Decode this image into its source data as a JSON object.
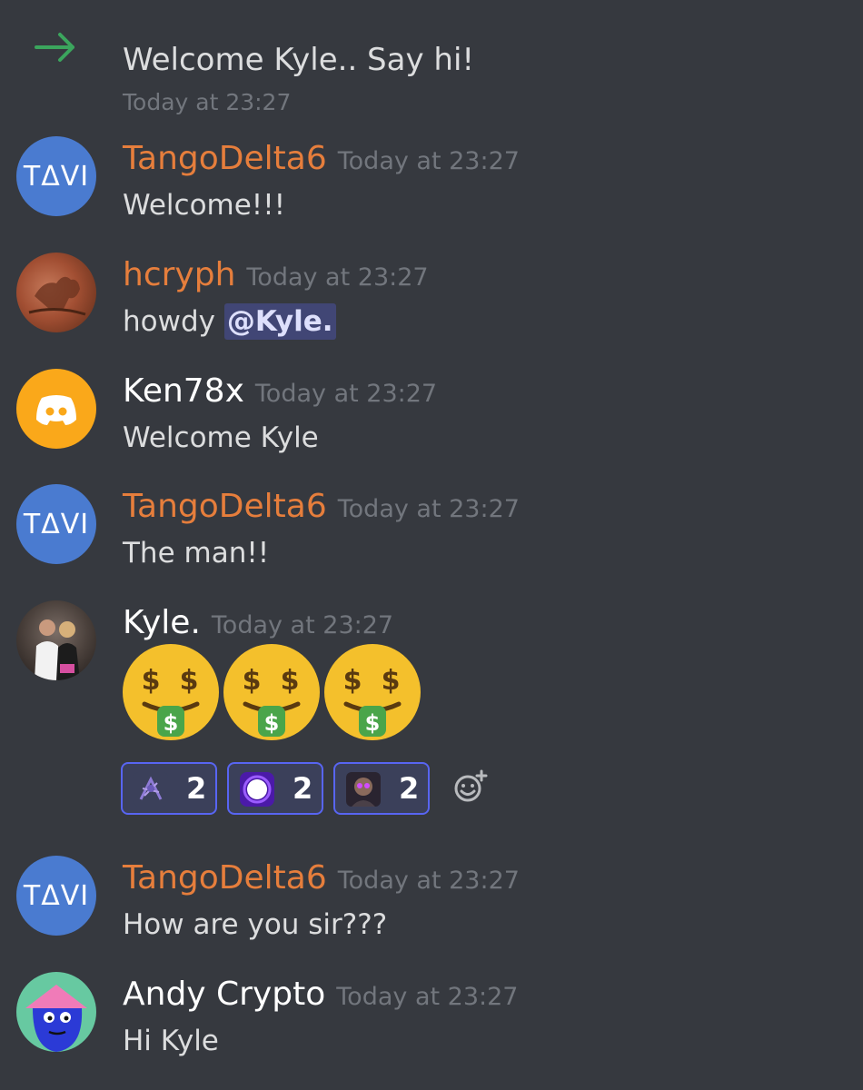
{
  "join_message": {
    "text": "Welcome Kyle.. Say hi!",
    "timestamp": "Today at 23:27"
  },
  "messages": [
    {
      "author": "TangoDelta6",
      "timestamp": "Today at 23:27",
      "text": "Welcome!!!",
      "avatar_text": "TΔVI",
      "name_color": "#e67e3c"
    },
    {
      "author": "hcryph",
      "timestamp": "Today at 23:27",
      "text_prefix": "howdy ",
      "mention": "@Kyle.",
      "name_color": "#e67e3c"
    },
    {
      "author": "Ken78x",
      "timestamp": "Today at 23:27",
      "text": "Welcome Kyle",
      "name_color": "#ffffff"
    },
    {
      "author": "TangoDelta6",
      "timestamp": "Today at 23:27",
      "text": "The man!!",
      "avatar_text": "TΔVI",
      "name_color": "#e67e3c"
    },
    {
      "author": "Kyle.",
      "timestamp": "Today at 23:27",
      "emojis": [
        "money-mouth-face",
        "money-mouth-face",
        "money-mouth-face"
      ],
      "reactions": [
        {
          "icon": "meme-character-icon",
          "count": "2"
        },
        {
          "icon": "purple-orb-icon",
          "count": "2"
        },
        {
          "icon": "glowing-eyes-face-icon",
          "count": "2"
        }
      ],
      "name_color": "#ffffff"
    },
    {
      "author": "TangoDelta6",
      "timestamp": "Today at 23:27",
      "text": "How are you sir???",
      "avatar_text": "TΔVI",
      "name_color": "#e67e3c"
    },
    {
      "author": "Andy Crypto",
      "timestamp": "Today at 23:27",
      "text": "Hi Kyle",
      "name_color": "#ffffff"
    }
  ],
  "colors": {
    "background": "#36393f",
    "join_arrow": "#3ba55d",
    "mention_bg": "#414675",
    "reaction_border": "#5865f2"
  }
}
